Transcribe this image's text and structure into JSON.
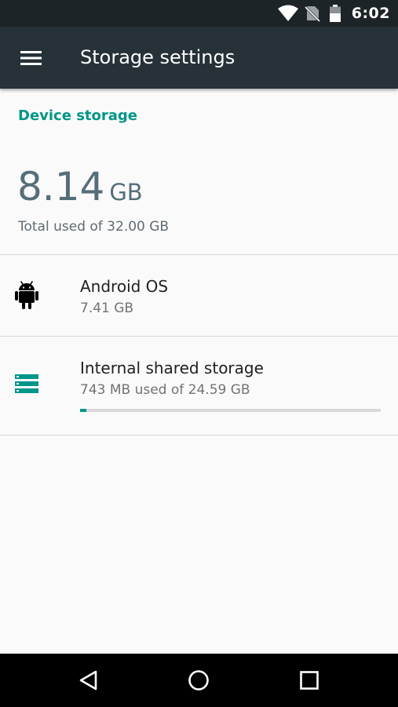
{
  "status_bar": {
    "time": "6:02",
    "icons": [
      "wifi-icon",
      "no-sim-icon",
      "battery-icon"
    ]
  },
  "app_bar": {
    "title": "Storage settings",
    "menu_icon": "menu-icon",
    "color": "#263238"
  },
  "device_storage": {
    "header": "Device storage",
    "used_value": "8.14",
    "used_unit": "GB",
    "total_text": "Total used of 32.00 GB"
  },
  "items": [
    {
      "icon": "android-icon",
      "title": "Android OS",
      "subtitle": "7.41 GB"
    },
    {
      "icon": "storage-icon",
      "title": "Internal shared storage",
      "subtitle": "743 MB used of 24.59 GB",
      "progress": 0.02
    }
  ],
  "nav_bar": {
    "icons": [
      "back-icon",
      "home-icon",
      "recents-icon"
    ]
  },
  "colors": {
    "accent": "#009688",
    "status_bar": "#1d2428",
    "background": "#fafafa"
  }
}
